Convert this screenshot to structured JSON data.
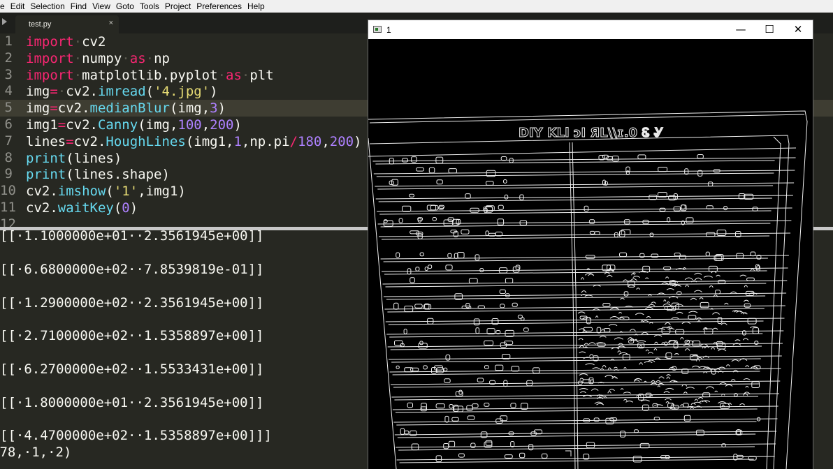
{
  "menu": [
    "e",
    "Edit",
    "Selection",
    "Find",
    "View",
    "Goto",
    "Tools",
    "Project",
    "Preferences",
    "Help"
  ],
  "tab": {
    "label": "test.py",
    "close": "×"
  },
  "gutter": [
    "1",
    "2",
    "3",
    "4",
    "5",
    "6",
    "7",
    "8",
    "9",
    "10",
    "11",
    "12"
  ],
  "code": [
    [
      {
        "t": "import",
        "c": "kw"
      },
      {
        "t": "·",
        "c": "ws"
      },
      {
        "t": "cv2",
        "c": ""
      }
    ],
    [
      {
        "t": "import",
        "c": "kw"
      },
      {
        "t": "·",
        "c": "ws"
      },
      {
        "t": "numpy",
        "c": ""
      },
      {
        "t": "·",
        "c": "ws"
      },
      {
        "t": "as",
        "c": "kw"
      },
      {
        "t": "·",
        "c": "ws"
      },
      {
        "t": "np",
        "c": ""
      }
    ],
    [
      {
        "t": "import",
        "c": "kw"
      },
      {
        "t": "·",
        "c": "ws"
      },
      {
        "t": "matplotlib.pyplot",
        "c": ""
      },
      {
        "t": "·",
        "c": "ws"
      },
      {
        "t": "as",
        "c": "kw"
      },
      {
        "t": "·",
        "c": "ws"
      },
      {
        "t": "plt",
        "c": ""
      }
    ],
    [
      {
        "t": "img",
        "c": ""
      },
      {
        "t": "=",
        "c": "kw"
      },
      {
        "t": "·",
        "c": "ws"
      },
      {
        "t": "cv2.",
        "c": ""
      },
      {
        "t": "imread",
        "c": "fn"
      },
      {
        "t": "(",
        "c": ""
      },
      {
        "t": "'4.jpg'",
        "c": "str"
      },
      {
        "t": ")",
        "c": ""
      }
    ],
    [
      {
        "t": "img",
        "c": ""
      },
      {
        "t": "=",
        "c": "kw"
      },
      {
        "t": "cv2.",
        "c": ""
      },
      {
        "t": "medianBlur",
        "c": "fn"
      },
      {
        "t": "(img,",
        "c": ""
      },
      {
        "t": "3",
        "c": "num"
      },
      {
        "t": ")",
        "c": ""
      }
    ],
    [
      {
        "t": "img1",
        "c": ""
      },
      {
        "t": "=",
        "c": "kw"
      },
      {
        "t": "cv2.",
        "c": ""
      },
      {
        "t": "Canny",
        "c": "fn"
      },
      {
        "t": "(img,",
        "c": ""
      },
      {
        "t": "100",
        "c": "num"
      },
      {
        "t": ",",
        "c": ""
      },
      {
        "t": "200",
        "c": "num"
      },
      {
        "t": ")",
        "c": ""
      }
    ],
    [
      {
        "t": "lines",
        "c": ""
      },
      {
        "t": "=",
        "c": "kw"
      },
      {
        "t": "cv2.",
        "c": ""
      },
      {
        "t": "HoughLines",
        "c": "fn"
      },
      {
        "t": "(img1,",
        "c": ""
      },
      {
        "t": "1",
        "c": "num"
      },
      {
        "t": ",np.pi",
        "c": ""
      },
      {
        "t": "/",
        "c": "kw"
      },
      {
        "t": "180",
        "c": "num"
      },
      {
        "t": ",",
        "c": ""
      },
      {
        "t": "200",
        "c": "num"
      },
      {
        "t": ")",
        "c": ""
      }
    ],
    [
      {
        "t": "print",
        "c": "fn"
      },
      {
        "t": "(lines)",
        "c": ""
      }
    ],
    [
      {
        "t": "print",
        "c": "fn"
      },
      {
        "t": "(lines.shape)",
        "c": ""
      }
    ],
    [
      {
        "t": "cv2.",
        "c": ""
      },
      {
        "t": "imshow",
        "c": "fn"
      },
      {
        "t": "(",
        "c": ""
      },
      {
        "t": "'1'",
        "c": "str"
      },
      {
        "t": ",img1)",
        "c": ""
      }
    ],
    [
      {
        "t": "cv2.",
        "c": ""
      },
      {
        "t": "waitKey",
        "c": "fn"
      },
      {
        "t": "(",
        "c": ""
      },
      {
        "t": "0",
        "c": "num"
      },
      {
        "t": ")",
        "c": ""
      }
    ],
    [
      {
        "t": "",
        "c": ""
      }
    ]
  ],
  "output": [
    "[[·1.1000000e+01··2.3561945e+00]]",
    "[[·6.6800000e+02··7.8539819e-01]]",
    "[[·1.2900000e+02··2.3561945e+00]]",
    "[[·2.7100000e+02··1.5358897e+00]]",
    "[[·6.2700000e+02··1.5533431e+00]]",
    "[[·1.8000000e+01··2.3561945e+00]]",
    "[[·4.4700000e+02··1.5358897e+00]]]",
    "178,·1,·2)"
  ],
  "window": {
    "title": "1",
    "minimize": "—",
    "maximize": "☐",
    "close": "✕",
    "image_text": "DIY KLl ɔI ЯL\\\\ɪ.0 Ꮛ Ꮍ"
  }
}
